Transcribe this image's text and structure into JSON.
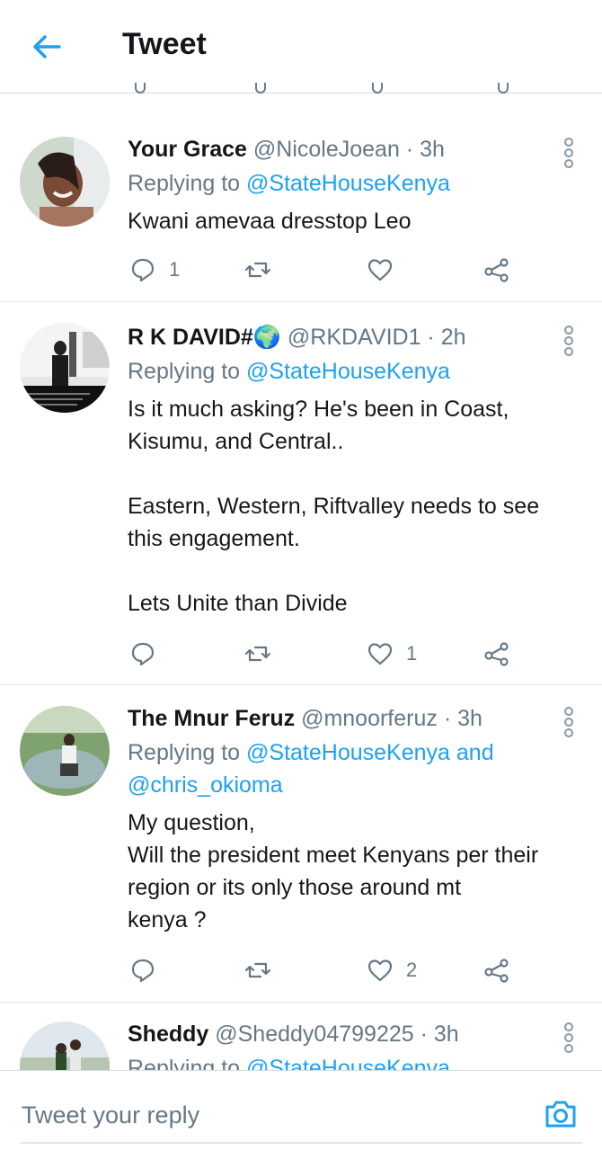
{
  "header": {
    "title": "Tweet"
  },
  "tweets": [
    {
      "name": "Your Grace",
      "handle": "@NicoleJoean · 3h",
      "reply_prefix": "Replying to ",
      "reply_to": "@StateHouseKenya",
      "reply_to_line2": "",
      "text": "Kwani  amevaa dresstop Leo",
      "replies": "1",
      "retweets": "",
      "likes": ""
    },
    {
      "name": "R K DAVID#🌍",
      "handle": "@RKDAVID1 · 2h",
      "reply_prefix": "Replying to ",
      "reply_to": "@StateHouseKenya",
      "reply_to_line2": "",
      "text": "Is it much asking? He's been in Coast,\nKisumu, and Central..\n\nEastern, Western, Riftvalley needs to see\nthis engagement.\n\nLets Unite than Divide",
      "replies": "",
      "retweets": "",
      "likes": "1"
    },
    {
      "name": "The Mnur Feruz",
      "handle": "@mnoorferuz · 3h",
      "reply_prefix": "Replying to ",
      "reply_to": "@StateHouseKenya and",
      "reply_to_line2": "@chris_okioma",
      "text": "My question,\nWill the president meet Kenyans per their\nregion or its only those around  mt\nkenya ?",
      "replies": "",
      "retweets": "",
      "likes": "2"
    },
    {
      "name": "Sheddy",
      "handle": "@Sheddy04799225 · 3h",
      "reply_prefix": "Replying to ",
      "reply_to": "@StateHouseKenya",
      "reply_to_line2": "",
      "text": "",
      "replies": "",
      "retweets": "",
      "likes": ""
    }
  ],
  "reply_bar": {
    "placeholder": "Tweet your reply"
  },
  "colors": {
    "accent": "#1da1f2",
    "secondary_text": "#657786",
    "primary_text": "#14171a",
    "divider": "#e1e8ed"
  },
  "icons": [
    "back-arrow-icon",
    "reply-icon",
    "retweet-icon",
    "like-icon",
    "share-icon",
    "more-options-icon",
    "camera-icon"
  ]
}
